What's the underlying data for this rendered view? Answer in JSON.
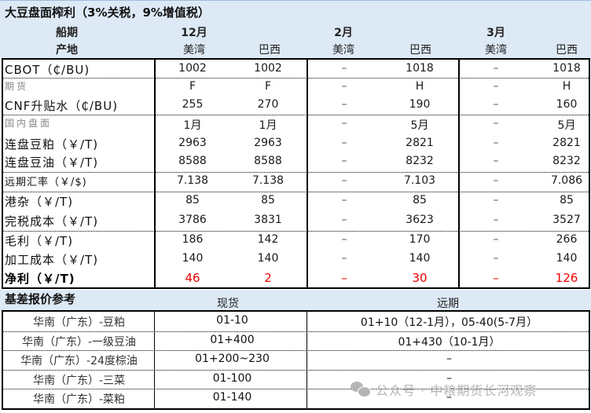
{
  "title": "大豆盘面榨利（3%关税，9%增值税）",
  "header": {
    "ship_label": "船期",
    "origin_label": "产地",
    "periods": [
      "12月",
      "2月",
      "3月"
    ],
    "origins": [
      "美湾",
      "巴西",
      "美湾",
      "巴西",
      "美湾",
      "巴西"
    ]
  },
  "rows": [
    {
      "label": "CBOT（₵/BU)",
      "values": [
        "1002",
        "1002",
        "–",
        "1018",
        "–",
        "1018"
      ]
    },
    {
      "label": "期货",
      "values": [
        "F",
        "F",
        "–",
        "H",
        "–",
        "H"
      ]
    },
    {
      "label": "CNF升贴水（₵/BU)",
      "values": [
        "255",
        "270",
        "–",
        "190",
        "–",
        "160"
      ]
    },
    {
      "label": "国内盘面",
      "values": [
        "1月",
        "1月",
        "–",
        "5月",
        "–",
        "5月"
      ]
    },
    {
      "label": "连盘豆粕（￥/T)",
      "values": [
        "2963",
        "2963",
        "–",
        "2821",
        "–",
        "2821"
      ]
    },
    {
      "label": "连盘豆油（￥/T)",
      "values": [
        "8588",
        "8588",
        "–",
        "8232",
        "–",
        "8232"
      ]
    },
    {
      "label": "远期汇率（￥/$)",
      "values": [
        "7.138",
        "7.138",
        "–",
        "7.103",
        "–",
        "7.086"
      ]
    },
    {
      "label": "港杂（￥/T)",
      "values": [
        "85",
        "85",
        "–",
        "85",
        "–",
        "85"
      ]
    },
    {
      "label": "完税成本（￥/T)",
      "values": [
        "3786",
        "3831",
        "–",
        "3623",
        "–",
        "3527"
      ]
    },
    {
      "label": "毛利（￥/T)",
      "values": [
        "186",
        "142",
        "–",
        "170",
        "–",
        "266"
      ]
    },
    {
      "label": "加工成本（￥/T)",
      "values": [
        "140",
        "140",
        "–",
        "140",
        "–",
        "140"
      ]
    },
    {
      "label": "净利（￥/T)",
      "values": [
        "46",
        "2",
        "–",
        "30",
        "–",
        "126"
      ]
    }
  ],
  "basis": {
    "title": "基差报价参考",
    "spot_header": "现货",
    "forward_header": "远期",
    "rows": [
      {
        "label": "华南（广东）-豆粕",
        "spot": "01-10",
        "forward": "01+10（12-1月），05-40(5-7月）"
      },
      {
        "label": "华南（广东）-一级豆油",
        "spot": "01+400",
        "forward": "01+430（10-1月）"
      },
      {
        "label": "华南（广东）-24度棕油",
        "spot": "01+200~230",
        "forward": "–"
      },
      {
        "label": "华南（广东）-三菜",
        "spot": "01-100",
        "forward": "–"
      },
      {
        "label": "华南（广东）-菜粕",
        "spot": "01-140",
        "forward": "–"
      }
    ]
  },
  "watermark": "公众号 · 中粮期货长河观察",
  "colors": {
    "header_band": "#dde9f5",
    "net_profit": "#f00000"
  }
}
